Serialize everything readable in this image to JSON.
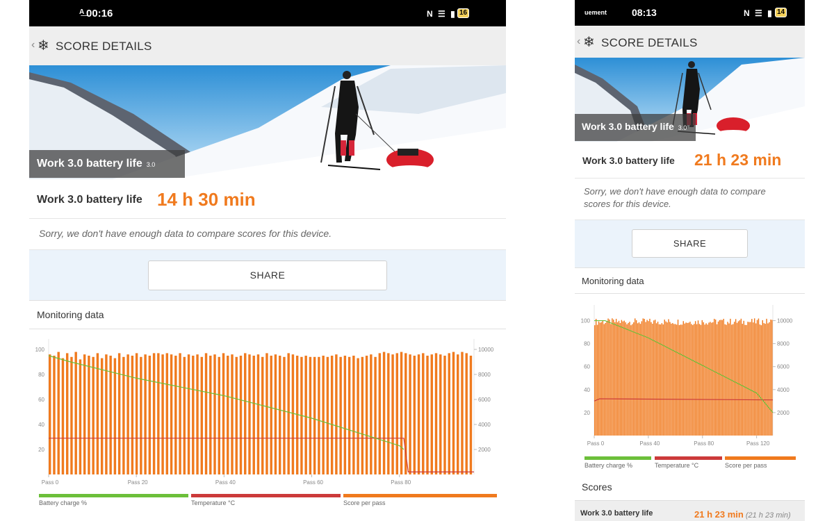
{
  "colors": {
    "accent_orange": "#f07a1e",
    "battery_line": "#6cbf3a",
    "temperature_line": "#cc3a3a",
    "score_bars": "#f07a1e",
    "share_background": "#ebf3fb"
  },
  "left": {
    "status": {
      "time": "00:16",
      "prefix": "A͟",
      "battery": "16",
      "icons": "N ☰ ▮"
    },
    "appbar": {
      "back_icon": "back-chevron",
      "logo_icon": "snowflake-icon",
      "title": "SCORE DETAILS"
    },
    "hero": {
      "label": "Work 3.0 battery life",
      "version": "3.0"
    },
    "score": {
      "label": "Work 3.0 battery life",
      "value": "14 h 30 min"
    },
    "sorry": "Sorry, we don't have enough data to compare scores for this device.",
    "share": "SHARE",
    "monitoring": "Monitoring data",
    "legend": [
      "Battery charge %",
      "Temperature °C",
      "Score per pass"
    ]
  },
  "right": {
    "status": {
      "time": "08:13",
      "carrier": "uement",
      "battery": "14",
      "icons": "N ☰ ▮"
    },
    "appbar": {
      "back_icon": "back-chevron",
      "logo_icon": "snowflake-icon",
      "title": "SCORE DETAILS"
    },
    "hero": {
      "label": "Work 3.0 battery life",
      "version": "3.0"
    },
    "score": {
      "label": "Work 3.0 battery life",
      "value": "21 h 23 min"
    },
    "sorry": "Sorry, we don't have enough data to compare scores for this device.",
    "share": "SHARE",
    "monitoring": "Monitoring data",
    "legend": [
      "Battery charge %",
      "Temperature °C",
      "Score per pass"
    ],
    "scores_title": "Scores",
    "scores_row": {
      "label": "Work 3.0 battery life",
      "value": "21 h 23 min",
      "sub": "(21 h 23 min)"
    }
  },
  "chart_data": [
    {
      "type": "bar",
      "x_ticks": [
        "Pass 0",
        "Pass 20",
        "Pass 40",
        "Pass 60",
        "Pass 80"
      ],
      "y_left_ticks": [
        "100",
        "80",
        "60",
        "40",
        "20"
      ],
      "y_right_ticks": [
        "10000",
        "8000",
        "6000",
        "4000",
        "2000"
      ],
      "ylim_left": [
        0,
        105
      ],
      "ylim_right": [
        0,
        10500
      ],
      "series": [
        {
          "name": "Battery charge %",
          "type": "line",
          "x": [
            0,
            5,
            20,
            40,
            60,
            70,
            80,
            81
          ],
          "values": [
            95,
            90,
            77,
            63,
            45,
            34,
            23,
            20
          ]
        },
        {
          "name": "Temperature °C",
          "type": "line",
          "x": [
            0,
            81,
            82,
            97
          ],
          "values": [
            29,
            29,
            2,
            2
          ]
        },
        {
          "name": "Score per pass",
          "type": "bar",
          "count": 98,
          "values": [
            9600,
            9500,
            9800,
            9300,
            9700,
            9400,
            9800,
            9200,
            9600,
            9500,
            9400,
            9700,
            9300,
            9600,
            9500,
            9300,
            9700,
            9400,
            9600,
            9500,
            9700,
            9400,
            9600,
            9500,
            9700,
            9700,
            9600,
            9700,
            9600,
            9500,
            9700,
            9400,
            9600,
            9500,
            9600,
            9400,
            9700,
            9500,
            9600,
            9400,
            9700,
            9500,
            9600,
            9400,
            9500,
            9700,
            9600,
            9500,
            9600,
            9400,
            9700,
            9500,
            9600,
            9500,
            9400,
            9700,
            9600,
            9500,
            9400,
            9500,
            9400,
            9400,
            9400,
            9500,
            9400,
            9500,
            9600,
            9400,
            9500,
            9400,
            9500,
            9300,
            9400,
            9500,
            9600,
            9400,
            9700,
            9800,
            9700,
            9600,
            9700,
            9800,
            9700,
            9600,
            9500,
            9600,
            9700,
            9500,
            9600,
            9700,
            9600,
            9500,
            9700,
            9800,
            9600,
            9800,
            9700,
            9500
          ]
        }
      ]
    },
    {
      "type": "bar",
      "x_ticks": [
        "Pass 0",
        "Pass 40",
        "Pass 80",
        "Pass 120"
      ],
      "y_left_ticks": [
        "100",
        "80",
        "60",
        "40",
        "20"
      ],
      "y_right_ticks": [
        "10000",
        "8000",
        "6000",
        "4000",
        "2000"
      ],
      "ylim_left": [
        0,
        110
      ],
      "ylim_right": [
        0,
        11000
      ],
      "series": [
        {
          "name": "Battery charge %",
          "type": "line",
          "x": [
            0,
            8,
            40,
            80,
            120,
            132
          ],
          "values": [
            100,
            100,
            85,
            61,
            37,
            20
          ]
        },
        {
          "name": "Temperature °C",
          "type": "line",
          "x": [
            0,
            4,
            132
          ],
          "values": [
            30,
            32,
            31
          ]
        },
        {
          "name": "Score per pass",
          "type": "bar",
          "count": 133,
          "value_min": 9600,
          "value_max": 10200
        }
      ]
    }
  ]
}
